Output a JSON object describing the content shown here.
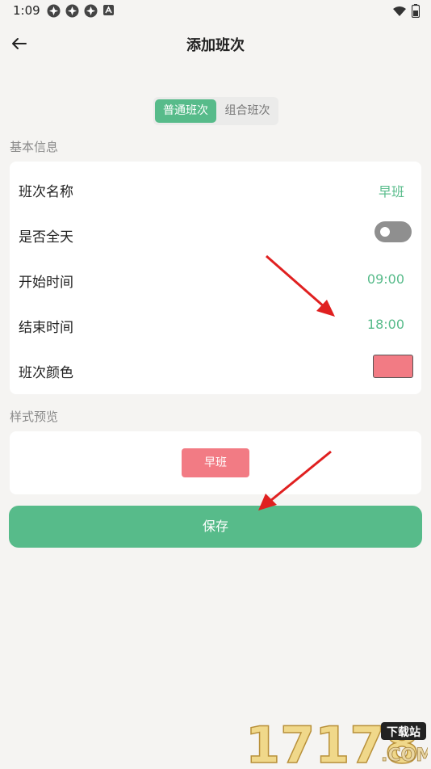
{
  "status_bar": {
    "time": "1:09"
  },
  "header": {
    "title": "添加班次"
  },
  "segment": {
    "tabs": [
      {
        "label": "普通班次",
        "active": true
      },
      {
        "label": "组合班次",
        "active": false
      }
    ]
  },
  "basic_info": {
    "label": "基本信息",
    "rows": [
      {
        "label": "班次名称",
        "value": "早班"
      },
      {
        "label": "是否全天",
        "toggle_on": false
      },
      {
        "label": "开始时间",
        "value": "09:00"
      },
      {
        "label": "结束时间",
        "value": "18:00"
      },
      {
        "label": "班次颜色",
        "color": "#f27b84"
      }
    ]
  },
  "preview": {
    "label": "样式预览",
    "chip_label": "早班",
    "chip_color": "#f27b84"
  },
  "save_label": "保存",
  "watermark": {
    "number": "17178",
    "tag": "下载站",
    "domain": ".COM"
  },
  "colors": {
    "accent": "#57bb8a",
    "annotation_arrow": "#e02020"
  }
}
